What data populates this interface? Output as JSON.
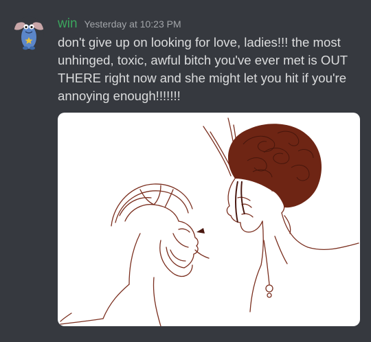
{
  "message": {
    "author": "win",
    "timestamp": "Yesterday at 10:23 PM",
    "text": "don't give up on looking for love, ladies!!! the most unhinged, toxic, awful bitch you've ever met is OUT THERE right now and she might let you hit if you're annoying enough!!!!!!!",
    "author_color": "#3ba55d"
  },
  "avatar": {
    "icon": "blue-creature-avatar-icon"
  },
  "attachment": {
    "icon": "sketch-drawing-image",
    "ink_color": "#6e2514"
  },
  "theme": {
    "background": "#36393f",
    "text": "#dcddde",
    "muted": "#a3a6aa"
  }
}
